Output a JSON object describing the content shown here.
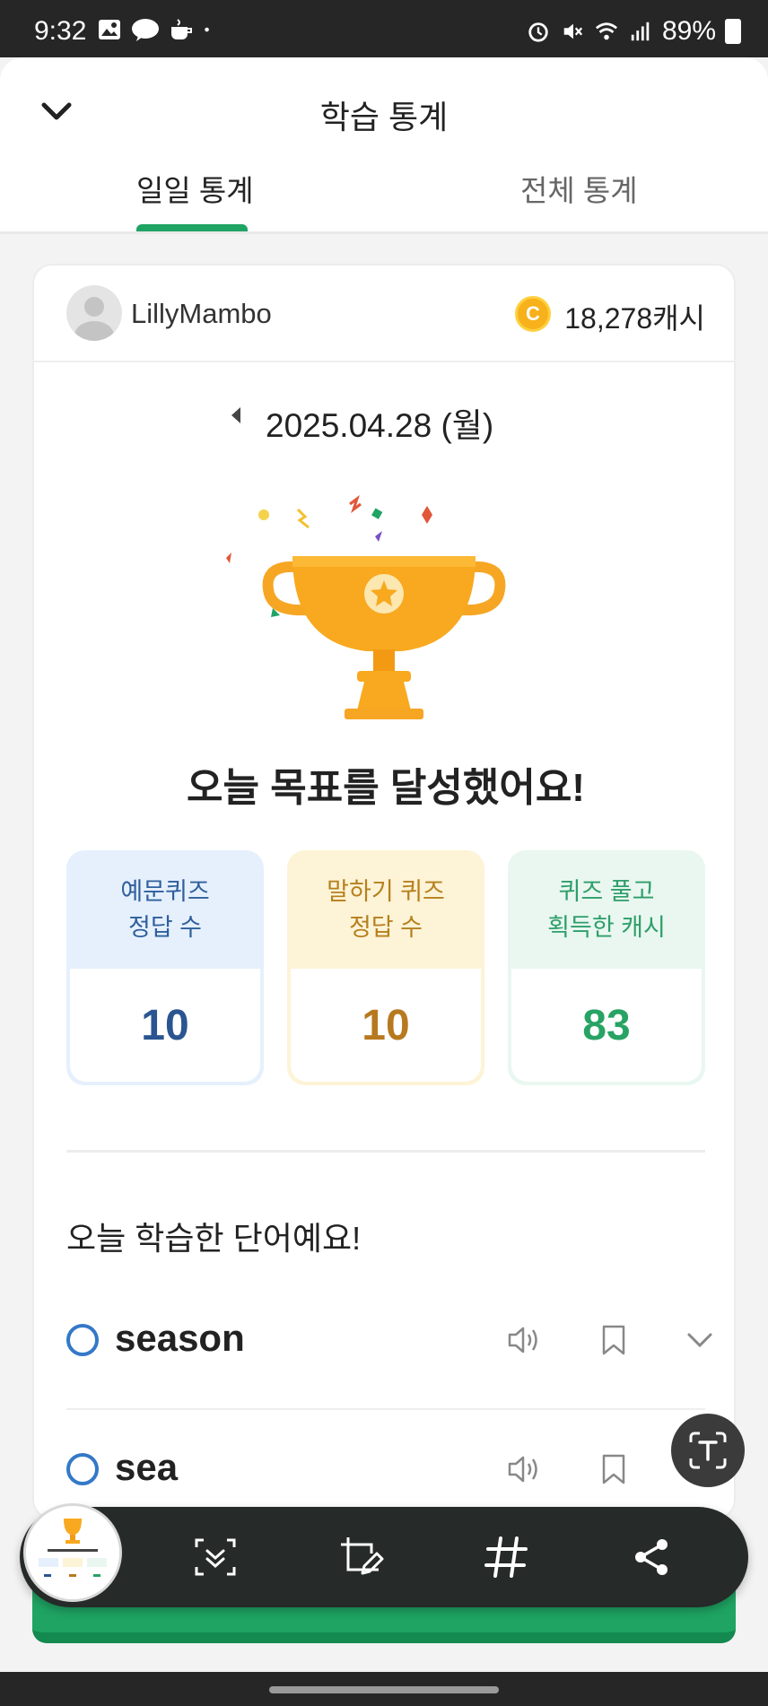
{
  "status_bar": {
    "time": "9:32",
    "battery": "89%",
    "notif_icons": [
      "image-icon",
      "talk-icon",
      "cup-icon",
      "dot-icon"
    ],
    "system_icons": [
      "alarm-icon",
      "mute-icon",
      "wifi-icon",
      "signal-icon",
      "battery-icon"
    ]
  },
  "header": {
    "title": "학습 통계",
    "tabs": [
      {
        "label": "일일 통계",
        "active": true
      },
      {
        "label": "전체 통계",
        "active": false
      }
    ]
  },
  "profile": {
    "username": "LillyMambo",
    "coin_letter": "C",
    "cash": "18,278캐시"
  },
  "date": "2025.04.28 (월)",
  "goal_message": "오늘 목표를 달성했어요!",
  "stats": [
    {
      "label_line1": "예문퀴즈",
      "label_line2": "정답 수",
      "value": "10"
    },
    {
      "label_line1": "말하기 퀴즈",
      "label_line2": "정답 수",
      "value": "10"
    },
    {
      "label_line1": "퀴즈 풀고",
      "label_line2": "획득한 캐시",
      "value": "83"
    }
  ],
  "words_title": "오늘 학습한 단어예요!",
  "words": [
    {
      "word": "season"
    },
    {
      "word": "sea"
    }
  ],
  "colors": {
    "accent_green": "#1fa463",
    "word_circle": "#3478c8"
  }
}
